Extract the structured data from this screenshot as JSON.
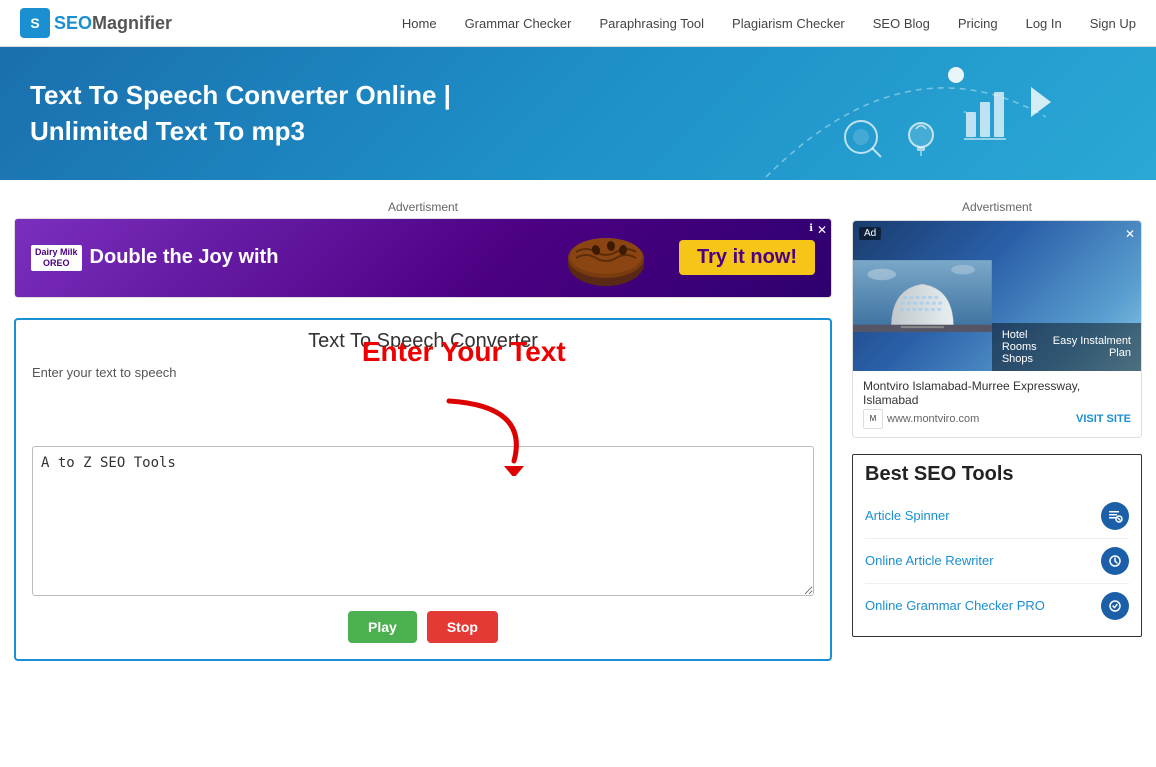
{
  "navbar": {
    "logo_seo": "SEO",
    "logo_magnifier": "Magnifier",
    "links": [
      {
        "label": "Home",
        "id": "home"
      },
      {
        "label": "Grammar Checker",
        "id": "grammar"
      },
      {
        "label": "Paraphrasing Tool",
        "id": "paraphrase"
      },
      {
        "label": "Plagiarism Checker",
        "id": "plagiarism"
      },
      {
        "label": "SEO Blog",
        "id": "seo-blog"
      },
      {
        "label": "Pricing",
        "id": "pricing"
      },
      {
        "label": "Log In",
        "id": "login"
      },
      {
        "label": "Sign Up",
        "id": "signup"
      }
    ]
  },
  "hero": {
    "title_line1": "Text To Speech Converter Online |",
    "title_line2": "Unlimited Text To mp3"
  },
  "ad_main": {
    "label": "Advertisment",
    "brand": "Dairy Milk\nOREO",
    "text": "Double the Joy with",
    "cta": "Try it now!"
  },
  "converter": {
    "title": "Text To Speech Converter",
    "input_label": "Enter your text to speech",
    "placeholder_text": "A to Z SEO ",
    "placeholder_blue": "Tools",
    "enter_text_label": "Enter Your Text",
    "btn_play": "Play",
    "btn_stop": "Stop"
  },
  "sidebar": {
    "ad_label": "Advertisment",
    "ad_name": "Montviro Islamabad-Murree Expressway, Islamabad",
    "ad_url": "www.montviro.com",
    "ad_visit": "VISIT SITE",
    "ad_overlay_left": "Hotel Rooms\nShops",
    "ad_overlay_right": "Easy Instalment Plan",
    "best_seo_title": "Best SEO Tools",
    "tools": [
      {
        "label": "Article Spinner",
        "icon": "✎"
      },
      {
        "label": "Online Article Rewriter",
        "icon": "✎"
      },
      {
        "label": "Online Grammar Checker PRO",
        "icon": "✎"
      }
    ]
  }
}
